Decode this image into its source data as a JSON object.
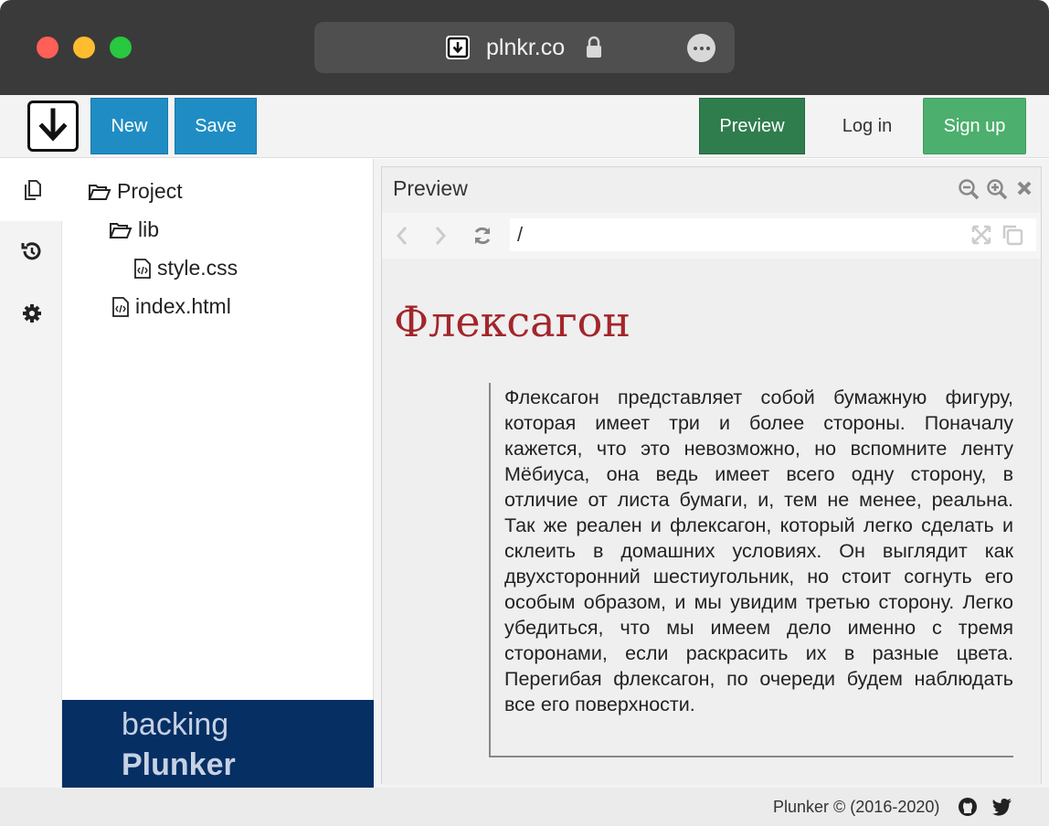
{
  "browser": {
    "url": "plnkr.co"
  },
  "toolbar": {
    "new_label": "New",
    "save_label": "Save",
    "preview_label": "Preview",
    "login_label": "Log in",
    "signup_label": "Sign up"
  },
  "rail": {
    "items": [
      {
        "icon": "files-icon",
        "active": true
      },
      {
        "icon": "history-icon",
        "active": false
      },
      {
        "icon": "gear-icon",
        "active": false
      }
    ]
  },
  "tree": {
    "items": [
      {
        "label": "Project",
        "type": "folder",
        "depth": 0
      },
      {
        "label": "lib",
        "type": "folder",
        "depth": 1
      },
      {
        "label": "style.css",
        "type": "file",
        "depth": 2
      },
      {
        "label": "index.html",
        "type": "file",
        "depth": 1
      }
    ]
  },
  "backing": {
    "line1": "backing",
    "line2": "Plunker"
  },
  "preview": {
    "title": "Preview",
    "address": "/",
    "heading": "Флексагон",
    "paragraph": "Флексагон представляет собой бумажную фигуру, которая имеет три и более стороны. Поначалу кажется, что это невозможно, но вспомните ленту Мёбиуса, она ведь имеет всего одну сторону, в отличие от листа бумаги, и, тем не менее, реальна. Так же реален и флексагон, который легко сделать и склеить в домашних условиях. Он выглядит как двухсторонний шестиугольник, но стоит согнуть его особым образом, и мы увидим третью сторону. Легко убедиться, что мы имеем дело именно с тремя сторонами, если раскрасить их в разные цвета. Перегибая флексагон, по очереди будем наблюдать все его поверхности."
  },
  "footer": {
    "credit": "Plunker © (2016-2020)"
  },
  "colors": {
    "primary_button": "#1f8dc3",
    "preview_button": "#2f7d4d",
    "signup_button": "#4caf6d",
    "heading": "#a2262b",
    "backing_bg": "#062f64"
  }
}
